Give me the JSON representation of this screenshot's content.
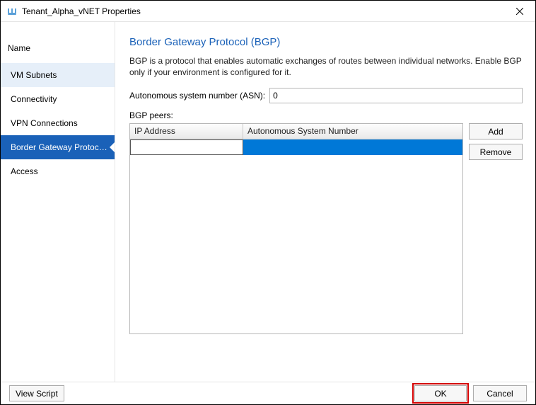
{
  "window": {
    "title": "Tenant_Alpha_vNET Properties"
  },
  "sidebar": {
    "header": "Name",
    "items": [
      {
        "label": "VM Subnets",
        "state": "mild"
      },
      {
        "label": "Connectivity",
        "state": ""
      },
      {
        "label": "VPN Connections",
        "state": ""
      },
      {
        "label": "Border Gateway Protocol...",
        "state": "selected"
      },
      {
        "label": "Access",
        "state": ""
      }
    ]
  },
  "content": {
    "title": "Border Gateway Protocol (BGP)",
    "description": "BGP is a protocol that enables automatic exchanges of routes between individual networks. Enable BGP only if your environment is configured for it.",
    "asn_label": "Autonomous system number (ASN):",
    "asn_value": "0",
    "peers_label": "BGP peers:",
    "grid": {
      "columns": {
        "ip": "IP Address",
        "asn": "Autonomous System Number"
      },
      "rows": [
        {
          "ip": "",
          "asn": "",
          "selected": true,
          "editing_ip": true
        }
      ]
    },
    "buttons": {
      "add": "Add",
      "remove": "Remove"
    }
  },
  "footer": {
    "view_script": "View Script",
    "ok": "OK",
    "cancel": "Cancel"
  }
}
